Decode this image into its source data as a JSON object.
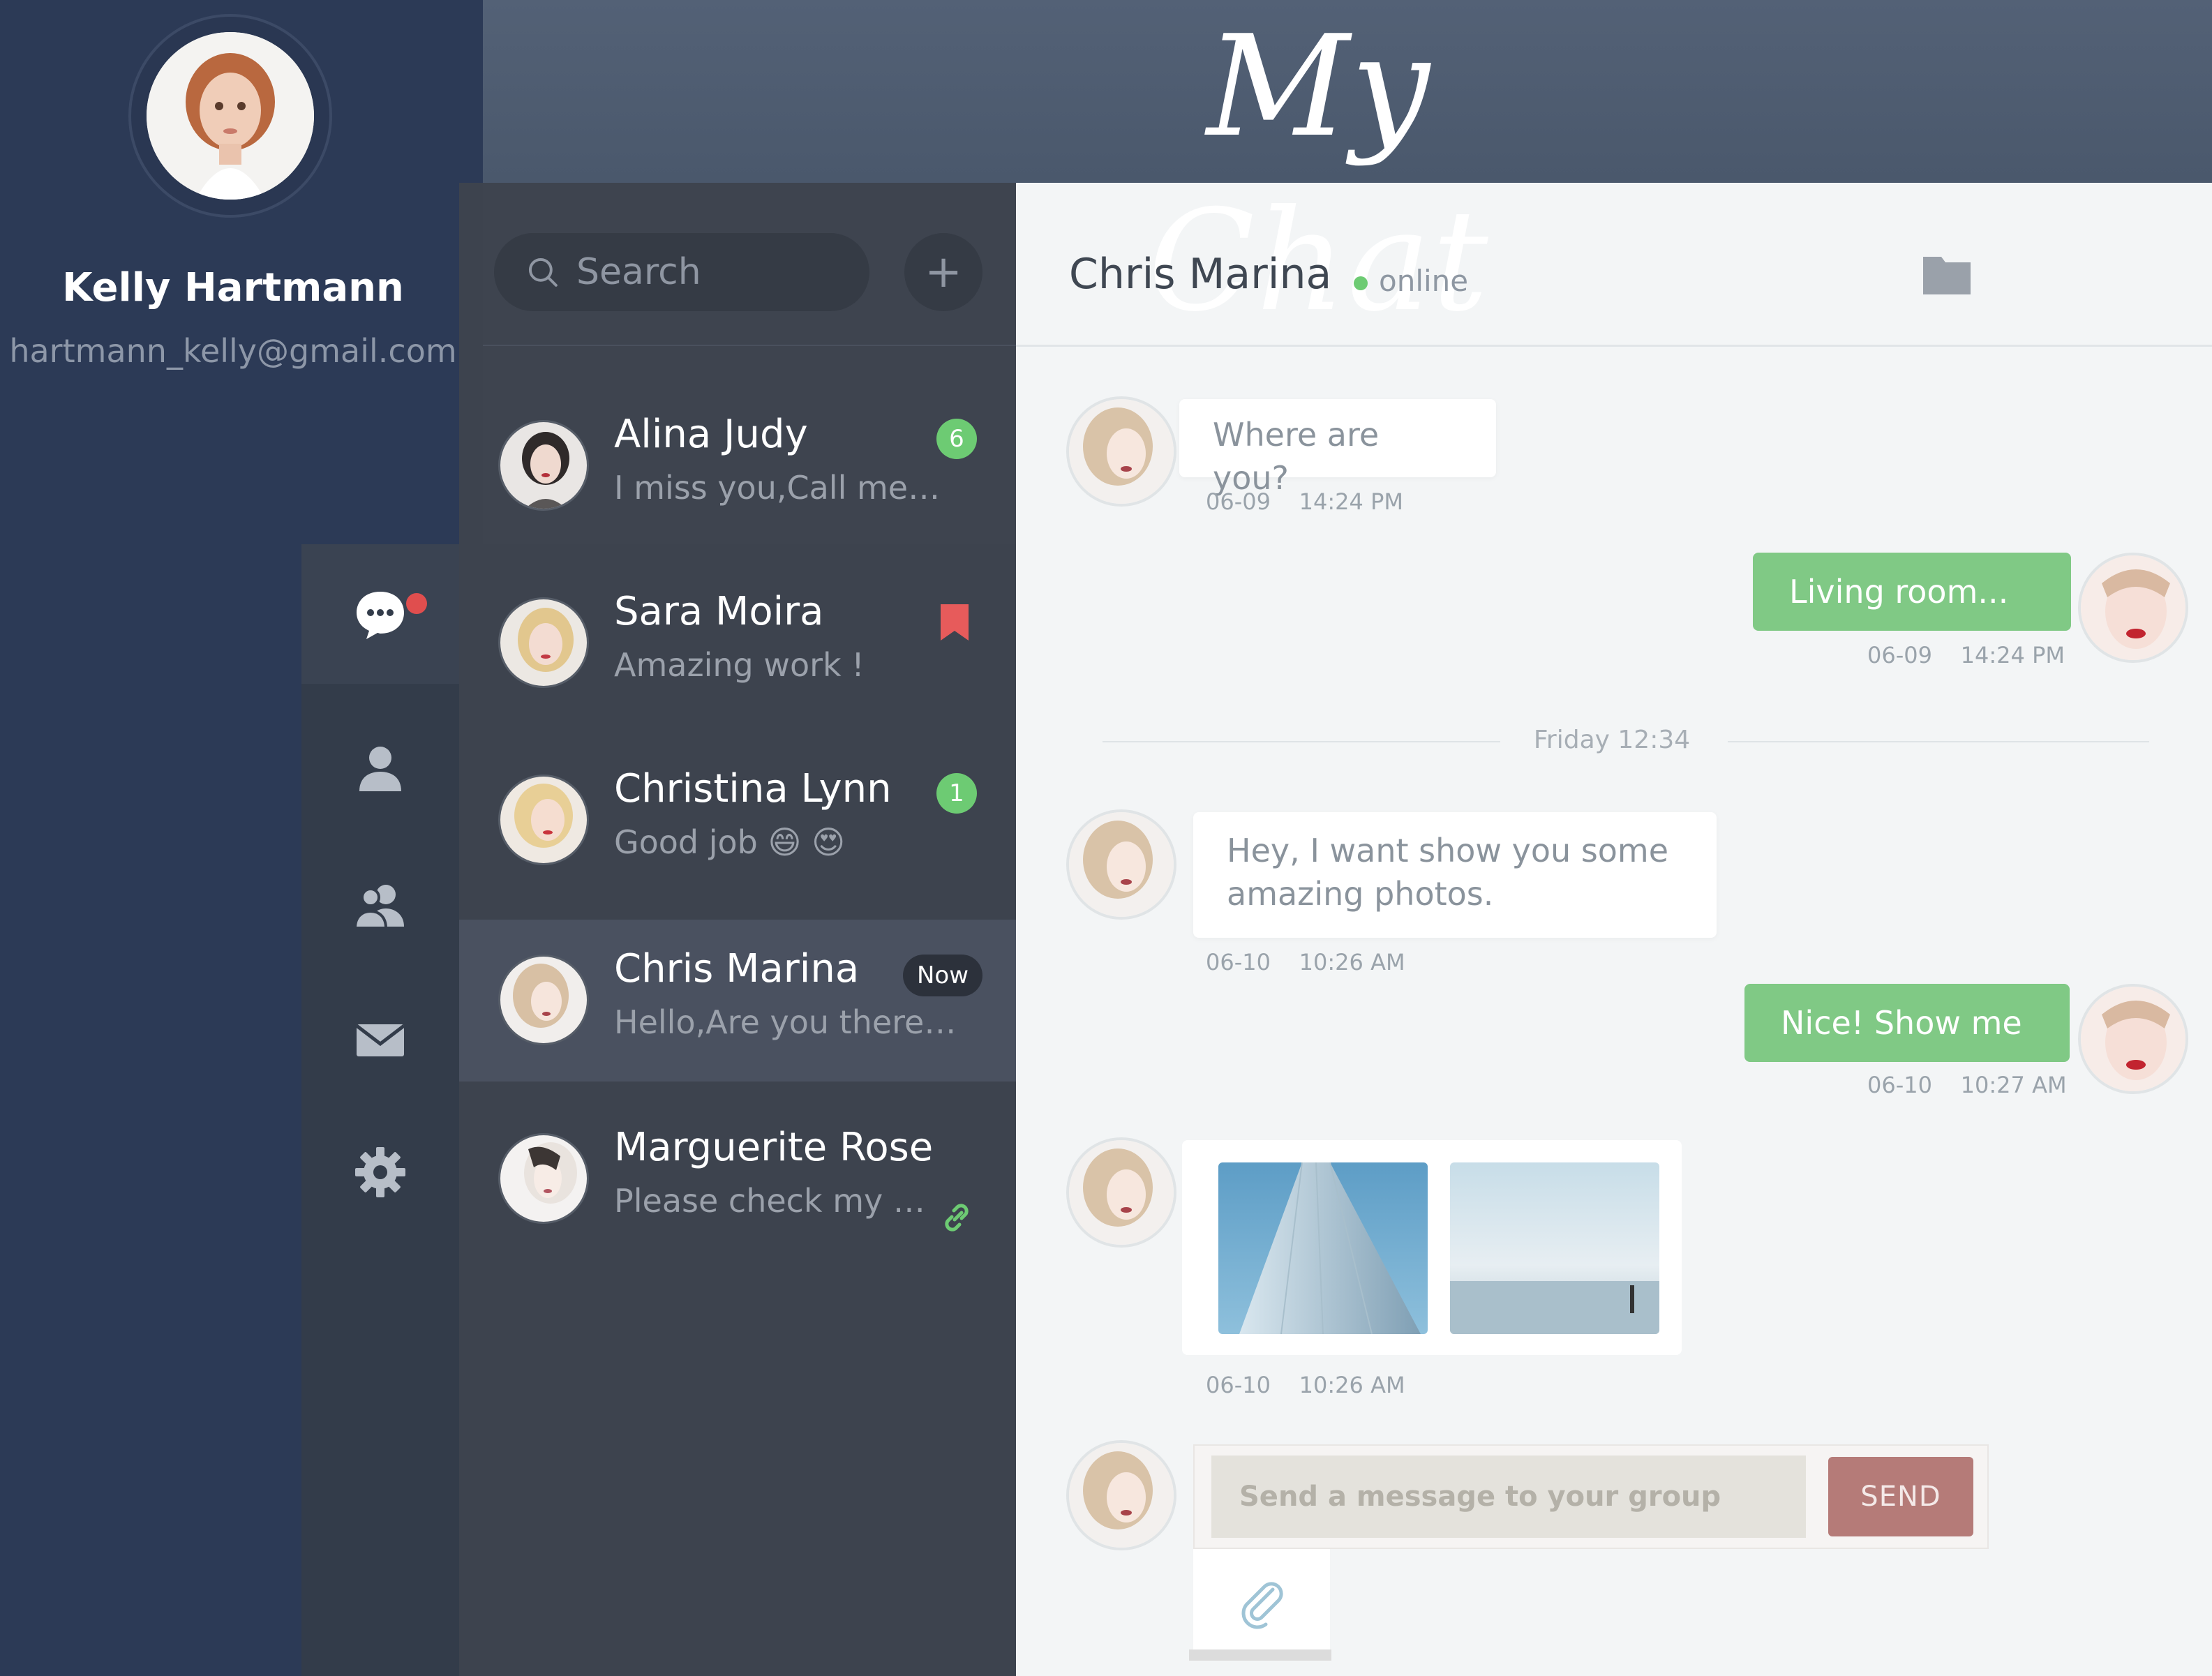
{
  "app": {
    "title": "My Chat"
  },
  "profile": {
    "name": "Kelly Hartmann",
    "email": "hartmann_kelly@gmail.com"
  },
  "rail": {
    "items": [
      "chat-icon",
      "user-icon",
      "users-icon",
      "mail-icon",
      "gear-icon"
    ],
    "active": "chat-icon"
  },
  "search": {
    "placeholder": "Search",
    "add_label": "+"
  },
  "conversations": [
    {
      "name": "Alina Judy",
      "preview": "I miss you,Call me…",
      "badge": "6"
    },
    {
      "name": "Sara Moira",
      "preview": "Amazing work !",
      "indicator": "bookmark-icon"
    },
    {
      "name": "Christina Lynn",
      "preview": "Good job  😄 😍",
      "badge": "1"
    },
    {
      "name": "Chris Marina",
      "preview": "Hello,Are you there…",
      "tag": "Now",
      "selected": true
    },
    {
      "name": "Marguerite Rose",
      "preview": "Please check my …",
      "indicator": "link-icon"
    }
  ],
  "chat": {
    "contact_name": "Chris Marina",
    "status": "online",
    "day_separator": "Friday 12:34",
    "messages": [
      {
        "direction": "in",
        "text": "Where are you?",
        "date": "06-09",
        "time": "14:24 PM"
      },
      {
        "direction": "out",
        "text": "Living room...",
        "date": "06-09",
        "time": "14:24 PM"
      },
      {
        "direction": "in",
        "text": "Hey,  I want show you some amazing photos.",
        "date": "06-10",
        "time": "10:26 AM"
      },
      {
        "direction": "out",
        "text": "Nice! Show me",
        "date": "06-10",
        "time": "10:27 AM"
      },
      {
        "direction": "in",
        "type": "images",
        "date": "06-10",
        "time": "10:26 AM"
      }
    ],
    "composer": {
      "placeholder": "Send a message to your group",
      "send_label": "SEND"
    }
  },
  "colors": {
    "sidebar": "#2c3a56",
    "list": "#3d434e",
    "accent_green": "#80c985",
    "badge_green": "#6dcb73",
    "notification_red": "#e04e4e",
    "send_button": "#b57b78"
  }
}
